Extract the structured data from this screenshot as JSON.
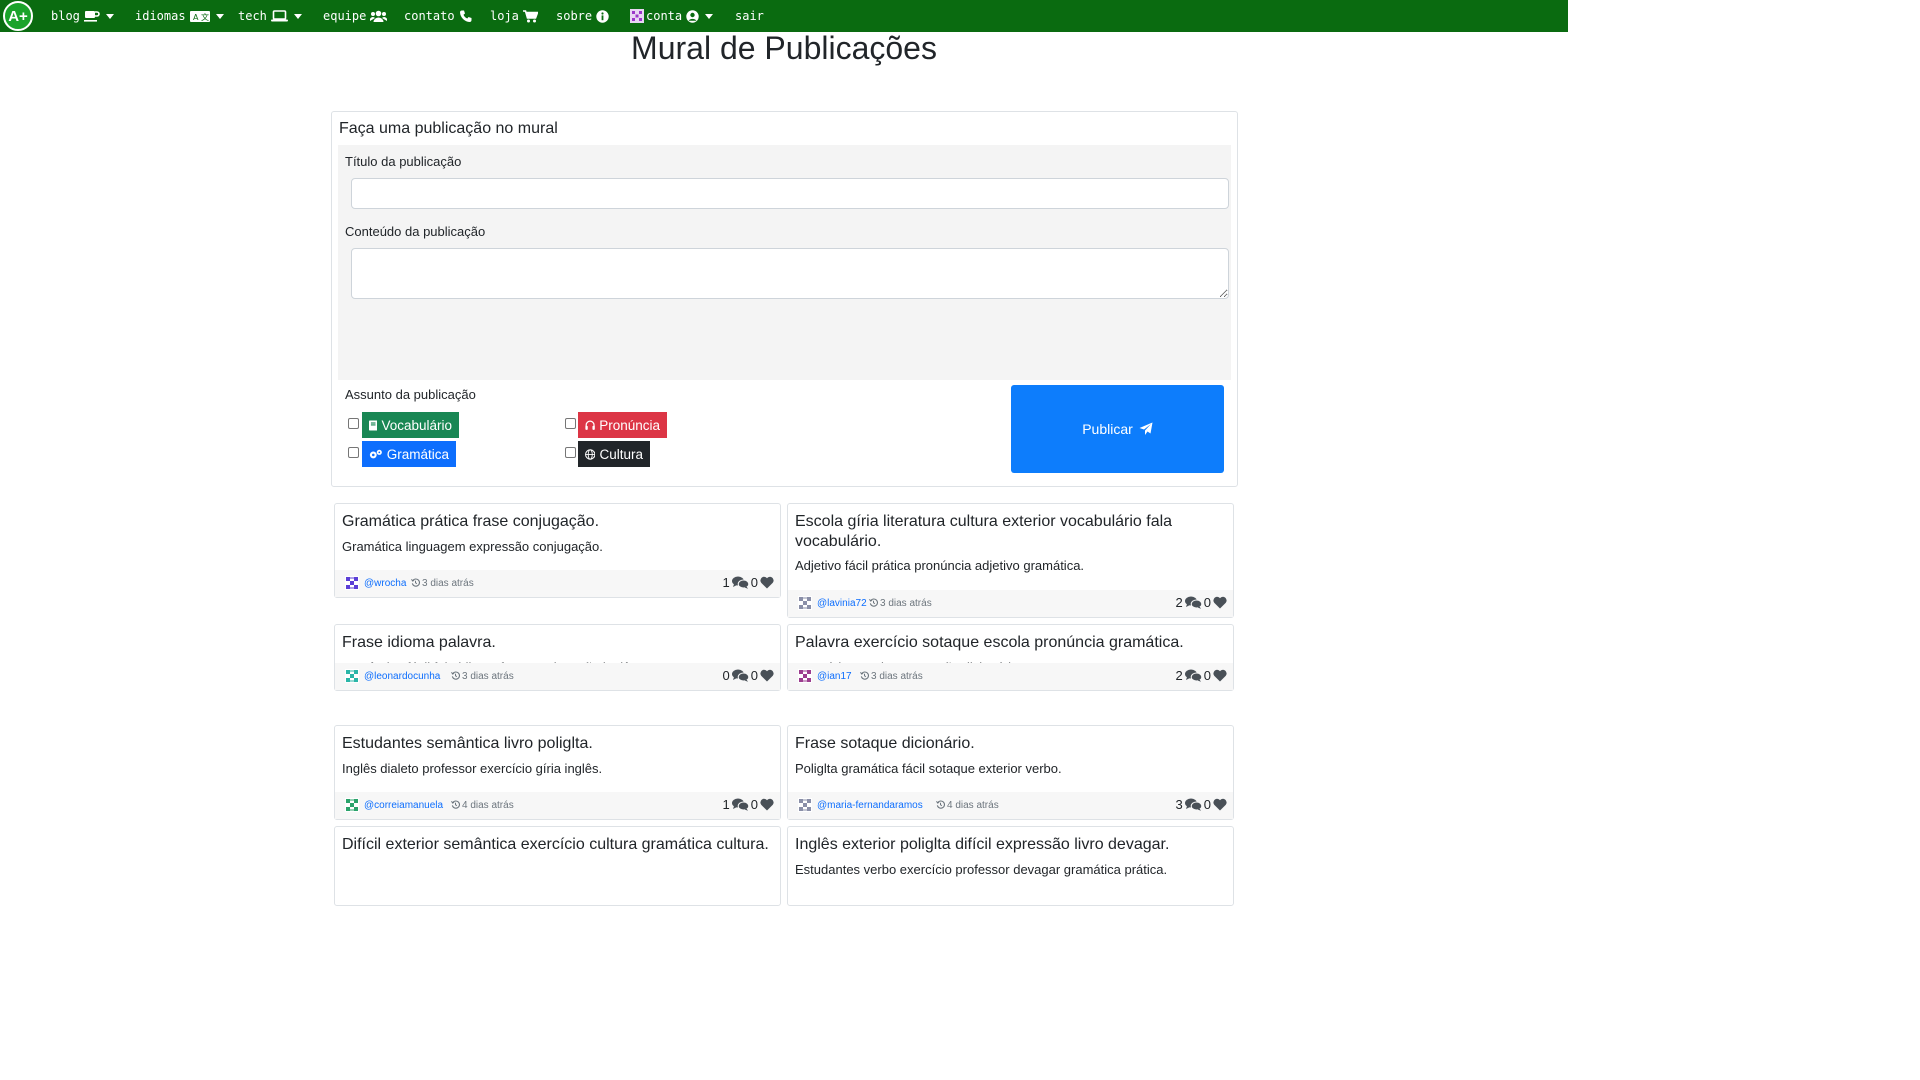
{
  "nav": {
    "logo": "A+",
    "items": [
      {
        "label": "blog",
        "icon": "coffee-icon",
        "dropdown": true
      },
      {
        "label": "idiomas",
        "icon": "language-icon",
        "dropdown": true
      },
      {
        "label": "tech",
        "icon": "laptop-icon",
        "dropdown": true
      },
      {
        "label": "equipe",
        "icon": "users-icon",
        "dropdown": false
      },
      {
        "label": "contato",
        "icon": "phone-icon",
        "dropdown": false
      },
      {
        "label": "loja",
        "icon": "cart-icon",
        "dropdown": false
      },
      {
        "label": "sobre",
        "icon": "info-icon",
        "dropdown": false
      },
      {
        "label": "conta",
        "icon": "user-circle-icon",
        "dropdown": true
      },
      {
        "label": "sair",
        "icon": "",
        "dropdown": false
      }
    ]
  },
  "page_title": "Mural de Publicações",
  "form": {
    "heading": "Faça uma publicação no mural",
    "title_label": "Título da publicação",
    "title_value": "",
    "content_label": "Conteúdo da publicação",
    "content_value": "",
    "subject_label": "Assunto da publicação",
    "subjects": [
      {
        "label": "Vocabulário",
        "color": "#198754",
        "icon": "book-icon",
        "checked": false
      },
      {
        "label": "Pronúncia",
        "color": "#dc3545",
        "icon": "headphones-icon",
        "checked": false
      },
      {
        "label": "Gramática",
        "color": "#0d6efd",
        "icon": "cogs-icon",
        "checked": false
      },
      {
        "label": "Cultura",
        "color": "#212529",
        "icon": "globe-icon",
        "checked": false
      }
    ],
    "submit_label": "Publicar"
  },
  "posts": [
    {
      "title": "Gramática prática frase conjugação.",
      "body": "Gramática linguagem expressão conjugação.",
      "user": "@wrocha",
      "time": "3 dias atrás",
      "comments": "1",
      "likes": "0",
      "avatar_color": "#5b3fd6"
    },
    {
      "title": "Escola gíria literatura cultura exterior vocabulário fala vocabulário.",
      "body": "Adjetivo fácil prática pronúncia adjetivo gramática.",
      "user": "@lavinia72",
      "time": "3 dias atrás",
      "comments": "2",
      "likes": "0",
      "avatar_color": "#8a8fa8"
    },
    {
      "title": "Frase idioma palavra.",
      "body": "Semântica fácil fala idioma frase conjugação inglês.",
      "user": "@leonardocunha",
      "time": "3 dias atrás",
      "comments": "0",
      "likes": "0",
      "avatar_color": "#2bb6a8"
    },
    {
      "title": "Palavra exercício sotaque escola pronúncia gramática.",
      "body": "Exercício exterior expressão dicionário.",
      "user": "@ian17",
      "time": "3 dias atrás",
      "comments": "2",
      "likes": "0",
      "avatar_color": "#9c3d8f"
    },
    {
      "title": "Estudantes semântica livro poliglta.",
      "body": "Inglês dialeto professor exercício gíria inglês.",
      "user": "@correiamanuela",
      "time": "4 dias atrás",
      "comments": "1",
      "likes": "0",
      "avatar_color": "#2aa36b"
    },
    {
      "title": "Frase sotaque dicionário.",
      "body": "Poliglta gramática fácil sotaque exterior verbo.",
      "user": "@maria-fernandaramos",
      "time": "4 dias atrás",
      "comments": "3",
      "likes": "0",
      "avatar_color": "#8a8fa8"
    },
    {
      "title": "Difícil exterior semântica exercício cultura gramática cultura.",
      "body": "",
      "user": "",
      "time": "",
      "comments": "",
      "likes": "",
      "avatar_color": "#888888"
    },
    {
      "title": "Inglês exterior poliglta difícil expressão livro devagar.",
      "body": "Estudantes verbo exercício professor devagar gramática prática.",
      "user": "",
      "time": "",
      "comments": "",
      "likes": "",
      "avatar_color": "#888888"
    }
  ]
}
